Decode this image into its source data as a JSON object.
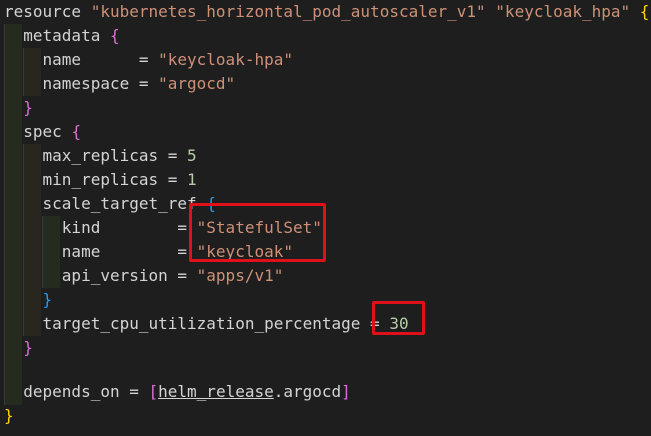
{
  "code": {
    "l1": {
      "kw": "resource",
      "type": "\"kubernetes_horizontal_pod_autoscaler_v1\"",
      "name": "\"keycloak_hpa\"",
      "brace": "{"
    },
    "l2": {
      "key": "metadata",
      "brace": "{"
    },
    "l3": {
      "key": "name      ",
      "eq": "= ",
      "val": "\"keycloak-hpa\""
    },
    "l4": {
      "key": "namespace ",
      "eq": "= ",
      "val": "\"argocd\""
    },
    "l5": {
      "brace": "}"
    },
    "l6": {
      "key": "spec",
      "brace": "{"
    },
    "l7": {
      "key": "max_replicas ",
      "eq": "= ",
      "val": "5"
    },
    "l8": {
      "key": "min_replicas ",
      "eq": "= ",
      "val": "1"
    },
    "l9": {
      "key": "scale_target_ref",
      "brace": "{"
    },
    "l10": {
      "key": "kind        ",
      "eq": "= ",
      "val": "\"StatefulSet\""
    },
    "l11": {
      "key": "name        ",
      "eq": "= ",
      "val": "\"keycloak\""
    },
    "l12": {
      "key": "api_version ",
      "eq": "= ",
      "val": "\"apps/v1\""
    },
    "l13": {
      "brace": "}"
    },
    "l14": {
      "key": "target_cpu_utilization_percentage ",
      "eq": "= ",
      "val": "30"
    },
    "l15": {
      "brace": "}"
    },
    "l17": {
      "key": "depends_on ",
      "eq": "= ",
      "open": "[",
      "ref1": "helm_release",
      "dot": ".argocd",
      "close": "]"
    },
    "l18": {
      "brace": "}"
    }
  },
  "colors": {
    "background": "#1e1e1e",
    "string": "#ce9178",
    "number": "#b5cea8",
    "bracket_level1": "#ffd700",
    "bracket_level2": "#da70d6",
    "bracket_level3": "#179fff",
    "highlight_box": "#e0101a"
  }
}
